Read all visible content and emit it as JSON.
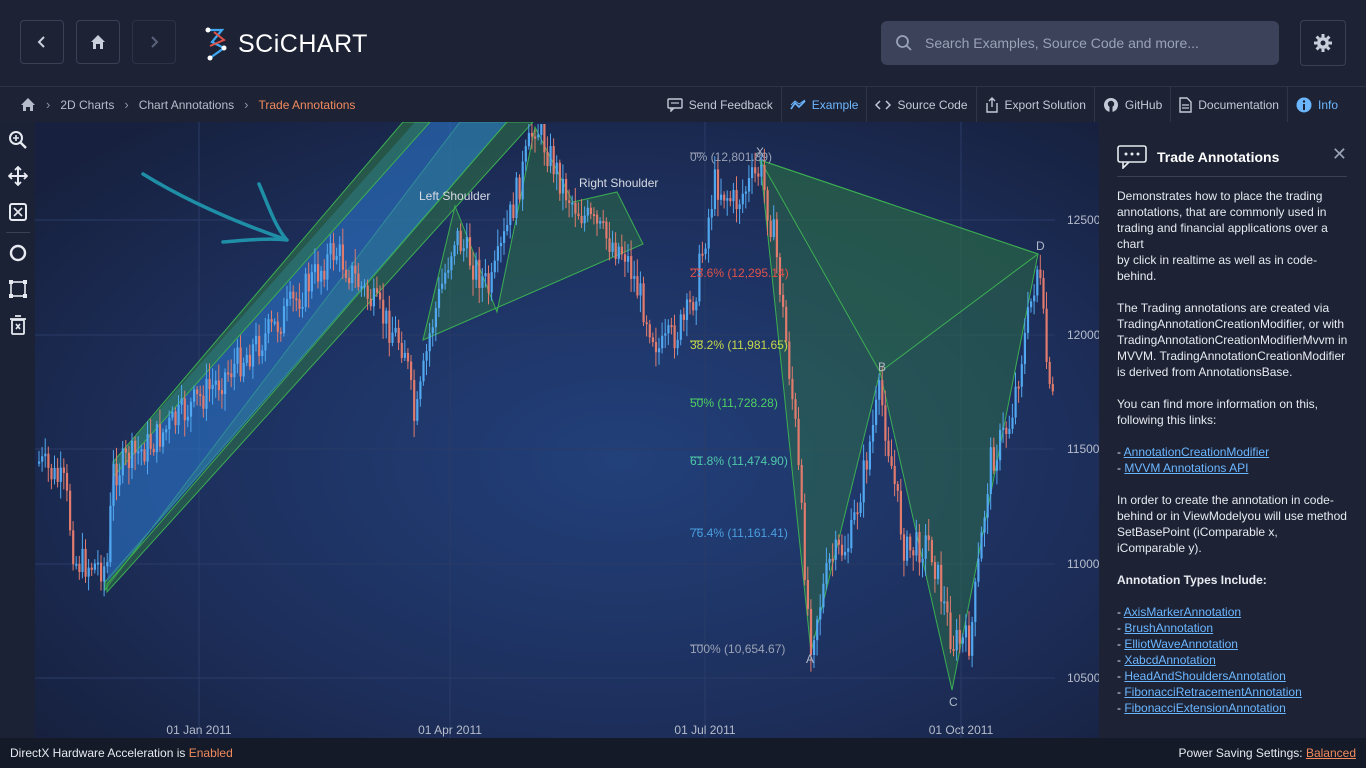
{
  "app": {
    "logo_text": "SCiCHART"
  },
  "search": {
    "placeholder": "Search Examples, Source Code and more..."
  },
  "breadcrumb": {
    "items": [
      "2D Charts",
      "Chart Annotations"
    ],
    "current": "Trade Annotations"
  },
  "actions": [
    {
      "label": "Send Feedback",
      "icon": "feedback-icon"
    },
    {
      "label": "Example",
      "icon": "chart-line-icon",
      "active": true
    },
    {
      "label": "Source Code",
      "icon": "code-icon"
    },
    {
      "label": "Export Solution",
      "icon": "export-icon"
    },
    {
      "label": "GitHub",
      "icon": "github-icon"
    },
    {
      "label": "Documentation",
      "icon": "document-icon"
    },
    {
      "label": "Info",
      "icon": "info-icon"
    }
  ],
  "chart": {
    "x_labels": [
      "01 Jan 2011",
      "01 Apr 2011",
      "01 Jul 2011",
      "01 Oct 2011"
    ],
    "y_labels": [
      "12500",
      "12000",
      "11500",
      "11000",
      "10500"
    ],
    "head_shoulders": {
      "left": "Left Shoulder",
      "right": "Right Shoulder"
    },
    "fib_levels": [
      {
        "label": "0% (12,801.89)",
        "color": "#9aa2b6"
      },
      {
        "label": "23.6% (12,295.14)",
        "color": "#e0514a"
      },
      {
        "label": "38.2% (11,981.65)",
        "color": "#c7d84a"
      },
      {
        "label": "50% (11,728.28)",
        "color": "#4fd163"
      },
      {
        "label": "61.8% (11,474.90)",
        "color": "#4fc7a8"
      },
      {
        "label": "76.4% (11,161.41)",
        "color": "#4a9fe0"
      },
      {
        "label": "100% (10,654.67)",
        "color": "#9aa2b6"
      }
    ],
    "xabcd": {
      "x": "X",
      "a": "A",
      "b": "B",
      "c": "C",
      "d": "D"
    },
    "colors": {
      "up": "#52a8f0",
      "down": "#e07b6e",
      "annotation_fill": "#2f7b43",
      "channel": "#2b74c8"
    }
  },
  "panel": {
    "title": "Trade Annotations",
    "para1": "Demonstrates how to place the trading annotations, that are commonly used in trading and financial applications over a chart\nby click in realtime as well as in code-behind.",
    "para2": "The Trading annotations are created via TradingAnnotationCreationModifier, or with TradingAnnotationCreationModifierMvvm in MVVM. TradingAnnotationCreationModifier is derived from AnnotationsBase.",
    "para3": "You can find more information on this, following this links:",
    "links": [
      "AnnotationCreationModifier",
      "MVVM Annotations API"
    ],
    "para4": "In order to create the annotation in code-behind or in ViewModelyou will use method SetBasePoint (iComparable x, iComparable y).",
    "types_heading": "Annotation Types Include:",
    "types": [
      "AxisMarkerAnnotation",
      "BrushAnnotation",
      "ElliotWaveAnnotation",
      "XabcdAnnotation",
      "HeadAndShouldersAnnotation",
      "FibonacciRetracementAnnotation",
      "FibonacciExtensionAnnotation"
    ]
  },
  "status": {
    "left_text": "DirectX Hardware Acceleration is ",
    "left_value": "Enabled",
    "right_text": "Power Saving Settings: ",
    "right_value": "Balanced"
  }
}
